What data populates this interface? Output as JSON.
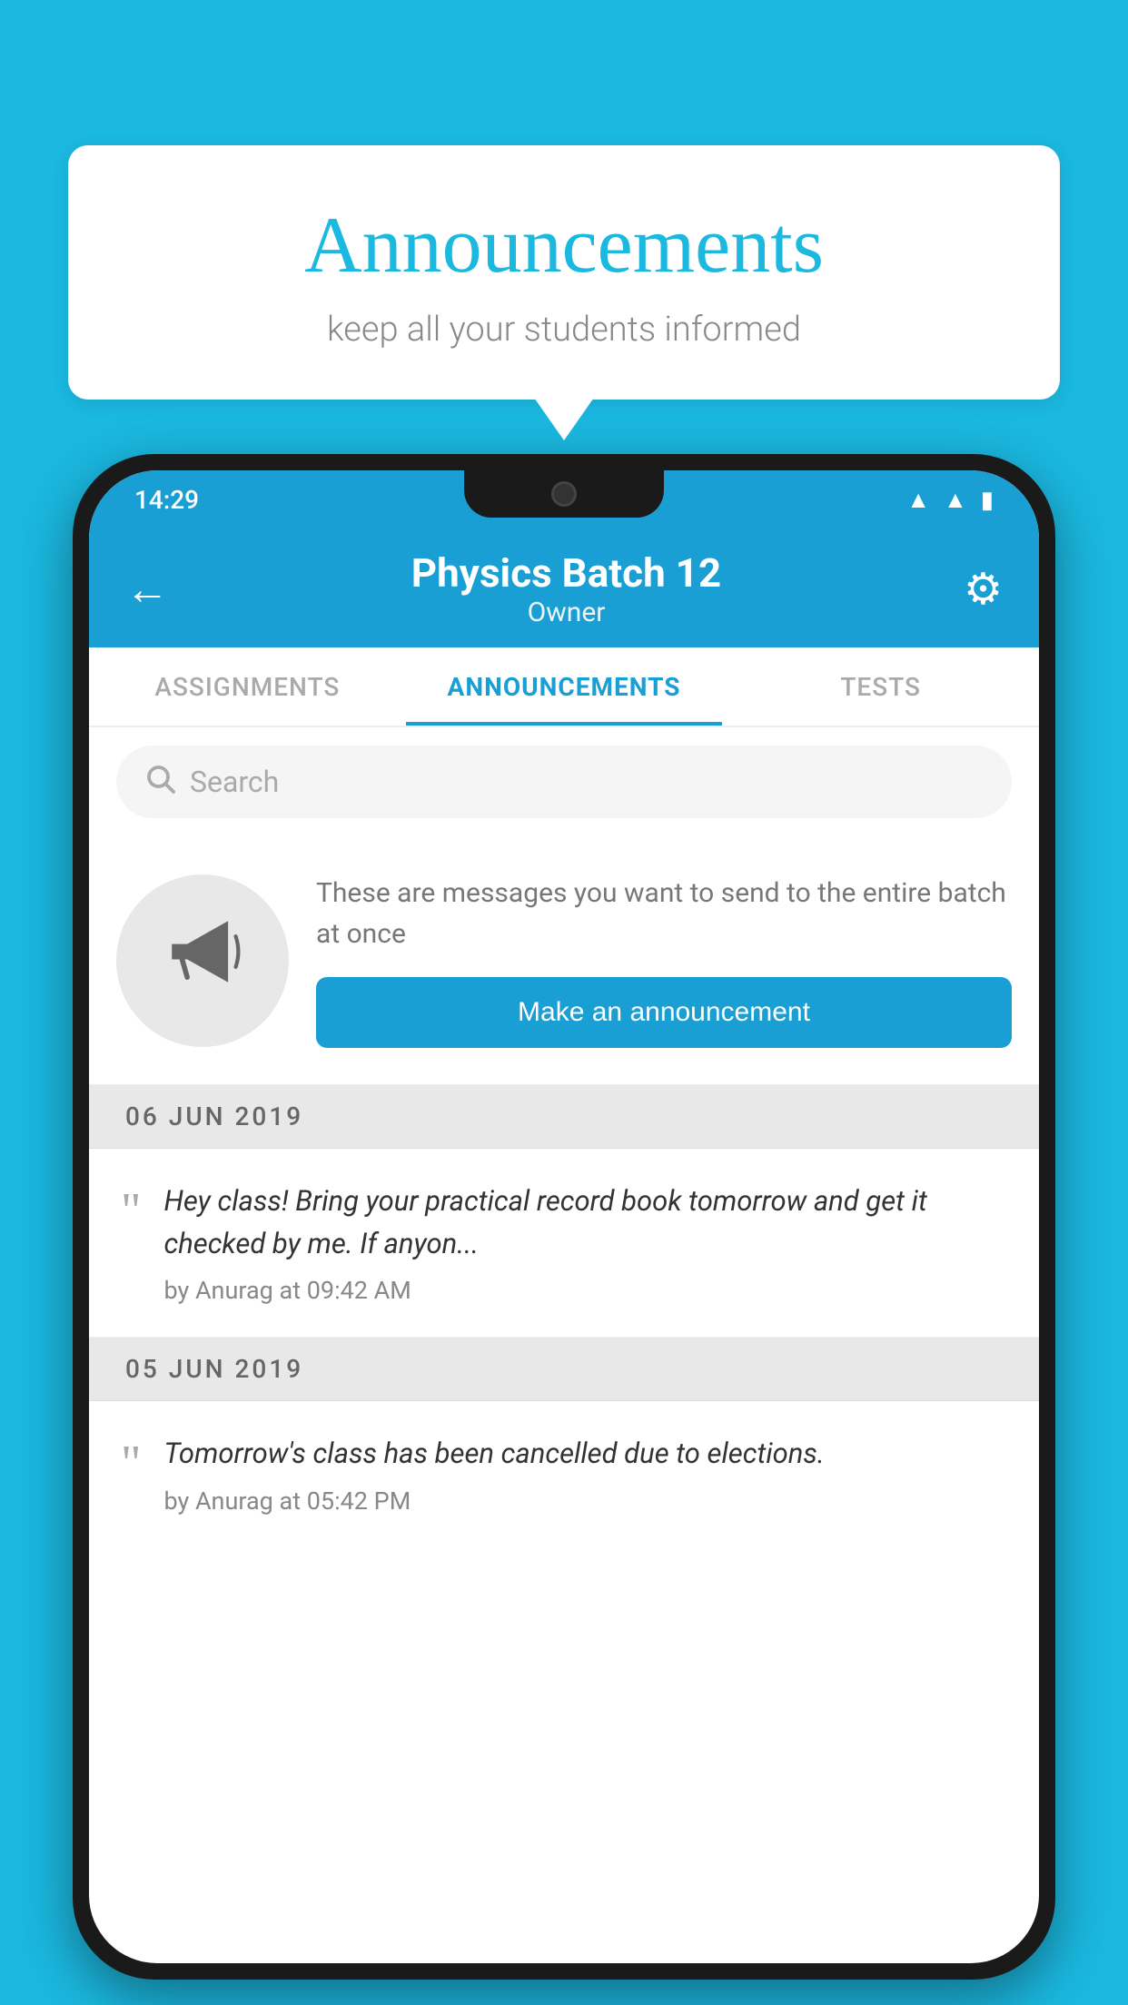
{
  "page": {
    "background_color": "#1BB8E0"
  },
  "speech_bubble": {
    "title": "Announcements",
    "subtitle": "keep all your students informed"
  },
  "phone": {
    "status_bar": {
      "time": "14:29"
    },
    "header": {
      "title": "Physics Batch 12",
      "subtitle": "Owner",
      "back_label": "←",
      "gear_label": "⚙"
    },
    "tabs": [
      {
        "label": "ASSIGNMENTS",
        "active": false
      },
      {
        "label": "ANNOUNCEMENTS",
        "active": true
      },
      {
        "label": "TESTS",
        "active": false
      }
    ],
    "search": {
      "placeholder": "Search"
    },
    "announcement_prompt": {
      "description": "These are messages you want to send to the entire batch at once",
      "button_label": "Make an announcement"
    },
    "announcements": [
      {
        "date": "06  JUN  2019",
        "text": "Hey class! Bring your practical record book tomorrow and get it checked by me. If anyon...",
        "meta": "by Anurag at 09:42 AM"
      },
      {
        "date": "05  JUN  2019",
        "text": "Tomorrow's class has been cancelled due to elections.",
        "meta": "by Anurag at 05:42 PM"
      }
    ]
  }
}
